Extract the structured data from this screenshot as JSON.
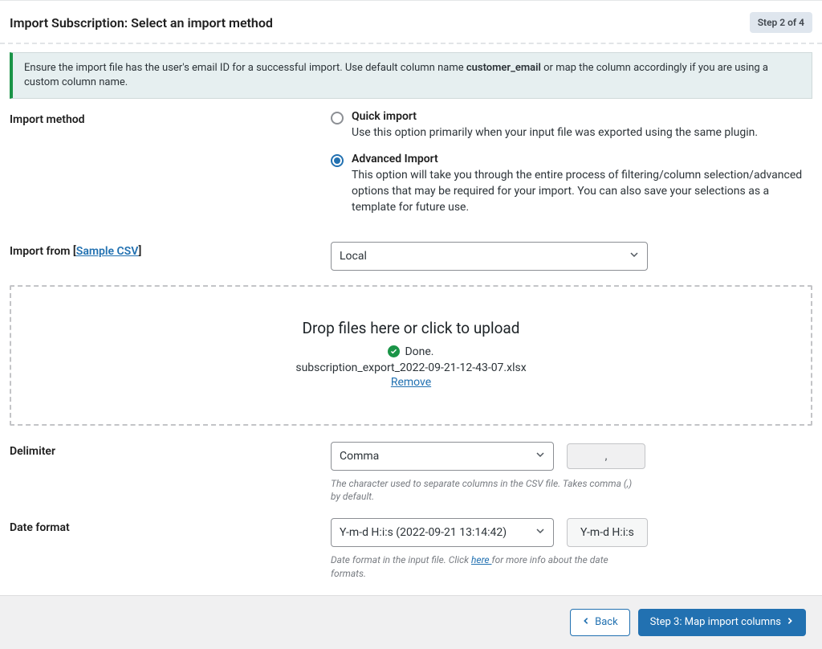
{
  "header": {
    "title": "Import Subscription: Select an import method",
    "step_badge": "Step 2 of 4"
  },
  "notice": {
    "pre": "Ensure the import file has the user's email ID for a successful import. Use default column name ",
    "bold": "customer_email",
    "post": " or map the column accordingly if you are using a custom column name."
  },
  "labels": {
    "import_method": "Import method",
    "import_from_pre": "Import from [",
    "sample_csv": "Sample CSV",
    "import_from_post": "]",
    "delimiter": "Delimiter",
    "date_format": "Date format"
  },
  "import_method": {
    "quick": {
      "title": "Quick import",
      "desc": "Use this option primarily when your input file was exported using the same plugin.",
      "selected": false
    },
    "advanced": {
      "title": "Advanced Import",
      "desc": "This option will take you through the entire process of filtering/column selection/advanced options that may be required for your import. You can also save your selections as a template for future use.",
      "selected": true
    }
  },
  "import_from": {
    "selected": "Local"
  },
  "dropzone": {
    "title": "Drop files here or click to upload",
    "status": "Done.",
    "filename": "subscription_export_2022-09-21-12-43-07.xlsx",
    "remove": "Remove"
  },
  "delimiter": {
    "selected": "Comma",
    "value": ",",
    "help": "The character used to separate columns in the CSV file. Takes comma (,) by default."
  },
  "date_format": {
    "selected": "Y-m-d H:i:s (2022-09-21 13:14:42)",
    "preview": "Y-m-d H:i:s",
    "help_pre": "Date format in the input file. Click ",
    "help_link": "here ",
    "help_post": "for more info about the date formats."
  },
  "footer": {
    "back": "Back",
    "next": "Step 3: Map import columns"
  }
}
